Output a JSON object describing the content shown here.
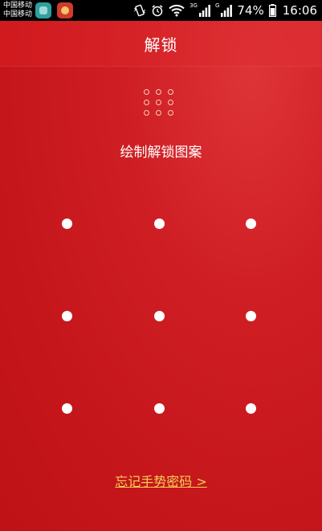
{
  "status_bar": {
    "carrier_1": "中国移动",
    "carrier_2": "中国移动",
    "network_1": "3G",
    "network_2": "G",
    "battery": "74%",
    "time": "16:06",
    "icons": [
      "teal-app-icon",
      "red-app-icon",
      "vibrate-icon",
      "alarm-icon",
      "wifi-icon",
      "signal-icon",
      "signal-icon",
      "battery-icon"
    ]
  },
  "header": {
    "title": "解锁"
  },
  "main": {
    "instruction": "绘制解锁图案",
    "forgot_link": "忘记手势密码 >"
  },
  "colors": {
    "background": "#c81a1f",
    "accent_link": "#f3cf55",
    "text": "#ffffff"
  }
}
